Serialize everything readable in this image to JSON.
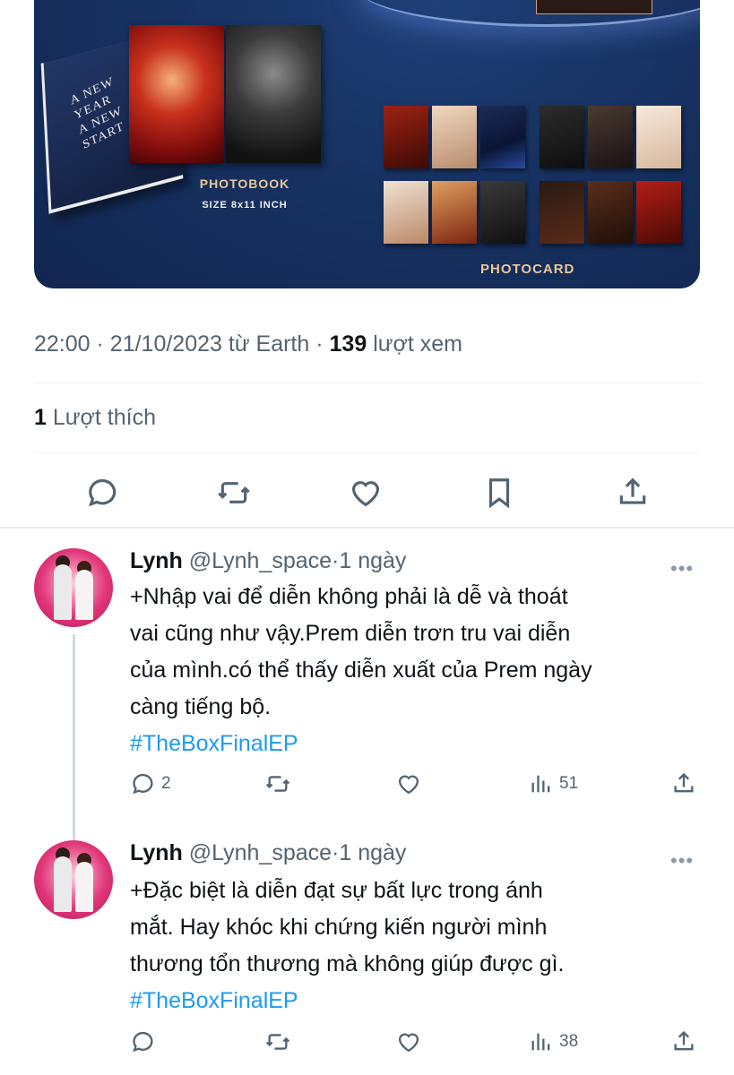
{
  "media": {
    "book_title": "A NEW\nYEAR\nA NEW\nSTART",
    "photobook_label": "PHOTOBOOK",
    "photobook_size": "SIZE 8x11 INCH",
    "photocard_label": "PHOTOCARD"
  },
  "tweet": {
    "time": "22:00",
    "date": "21/10/2023",
    "source_prefix": "từ",
    "source": "Earth",
    "views_count": "139",
    "views_label": "lượt xem",
    "likes_count": "1",
    "likes_label": "Lượt thích"
  },
  "actions": {
    "icons": [
      "reply-icon",
      "retweet-icon",
      "like-icon",
      "bookmark-icon",
      "share-icon"
    ]
  },
  "replies": [
    {
      "name": "Lynh",
      "handle": "@Lynh_space",
      "time": "1 ngày",
      "lines": [
        "+Nhập vai để diễn không phải là dễ và thoát",
        "vai cũng như vậy.Prem diễn trơn tru vai diễn",
        "của mình.có thể thấy diễn xuất của Prem ngày",
        "càng tiếng bộ."
      ],
      "hashtag": "#TheBoxFinalEP",
      "reply_count": "2",
      "view_count": "51"
    },
    {
      "name": "Lynh",
      "handle": "@Lynh_space",
      "time": "1 ngày",
      "lines": [
        "+Đặc biệt là diễn đạt sự bất lực trong ánh",
        "mắt. Hay khóc khi chứng kiến người mình",
        "thương tổn thương mà không giúp được gì."
      ],
      "hashtag": "#TheBoxFinalEP",
      "reply_count": "",
      "view_count": "38"
    }
  ],
  "colors": {
    "text_primary": "#0f1419",
    "text_secondary": "#536471",
    "hashtag": "#1d9bf0",
    "divider": "#eff3f4"
  }
}
